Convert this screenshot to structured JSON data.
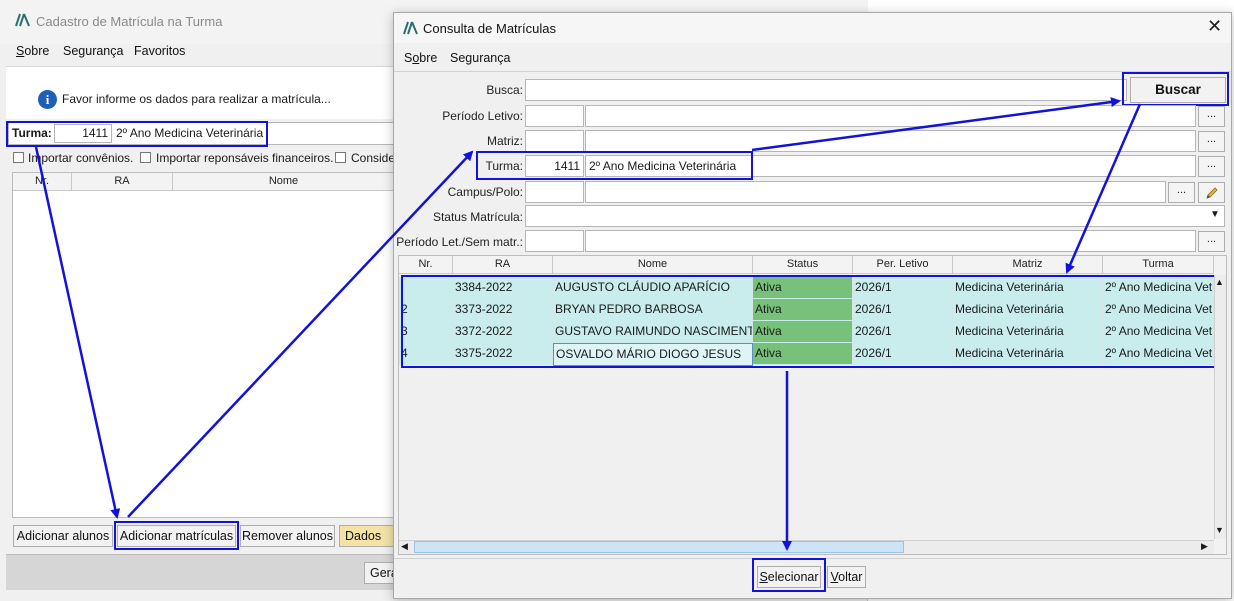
{
  "bg_window": {
    "title": "Cadastro de Matrícula na Turma",
    "menu": [
      "Sobre",
      "Segurança",
      "Favoritos"
    ],
    "info_text": "Favor informe os dados para realizar a matrícula...",
    "turma_label": "Turma:",
    "turma_code": "1411",
    "turma_name": "2º Ano Medicina Veterinária",
    "checkboxes": [
      "Importar convênios.",
      "Importar reponsáveis financeiros.",
      "Conside"
    ],
    "table_headers": [
      "Nr.",
      "RA",
      "Nome"
    ],
    "buttons": {
      "add_students": "Adicionar alunos",
      "add_enrollments": "Adicionar matrículas",
      "remove_students": "Remover alunos",
      "data_tab": "Dados da",
      "generate": "Gera"
    }
  },
  "dialog": {
    "title": "Consulta de Matrículas",
    "menu": [
      "Sobre",
      "Segurança"
    ],
    "labels": {
      "busca": "Busca:",
      "periodo": "Período Letivo:",
      "matriz": "Matriz:",
      "turma": "Turma:",
      "campus": "Campus/Polo:",
      "status": "Status Matrícula:",
      "periodo_sem": "Período Let./Sem matr.:"
    },
    "turma_code": "1411",
    "turma_name": "2º Ano Medicina Veterinária",
    "buscar_label": "Buscar",
    "ellipsis": "...",
    "columns": [
      "Nr.",
      "RA",
      "Nome",
      "Status",
      "Per. Letivo",
      "Matriz",
      "Turma"
    ],
    "rows": [
      {
        "nr": "",
        "ra": "3384-2022",
        "nome": "AUGUSTO CLÁUDIO APARÍCIO",
        "status": "Ativa",
        "periodo": "2026/1",
        "matriz": "Medicina Veterinária",
        "turma": "2º Ano Medicina Vet"
      },
      {
        "nr": "2",
        "ra": "3373-2022",
        "nome": "BRYAN PEDRO BARBOSA",
        "status": "Ativa",
        "periodo": "2026/1",
        "matriz": "Medicina Veterinária",
        "turma": "2º Ano Medicina Vet"
      },
      {
        "nr": "3",
        "ra": "3372-2022",
        "nome": "GUSTAVO RAIMUNDO NASCIMENTO",
        "status": "Ativa",
        "periodo": "2026/1",
        "matriz": "Medicina Veterinária",
        "turma": "2º Ano Medicina Vet"
      },
      {
        "nr": "4",
        "ra": "3375-2022",
        "nome": "OSVALDO MÁRIO DIOGO JESUS",
        "status": "Ativa",
        "periodo": "2026/1",
        "matriz": "Medicina Veterinária",
        "turma": "2º Ano Medicina Vet"
      }
    ],
    "select_label": "Selecionar",
    "back_label": "Voltar"
  },
  "colors": {
    "row_bg": "#c9ecec",
    "status_bg": "#77c17a",
    "highlight": "#1212d8",
    "data_tab_bg": "#f3e3a6"
  }
}
